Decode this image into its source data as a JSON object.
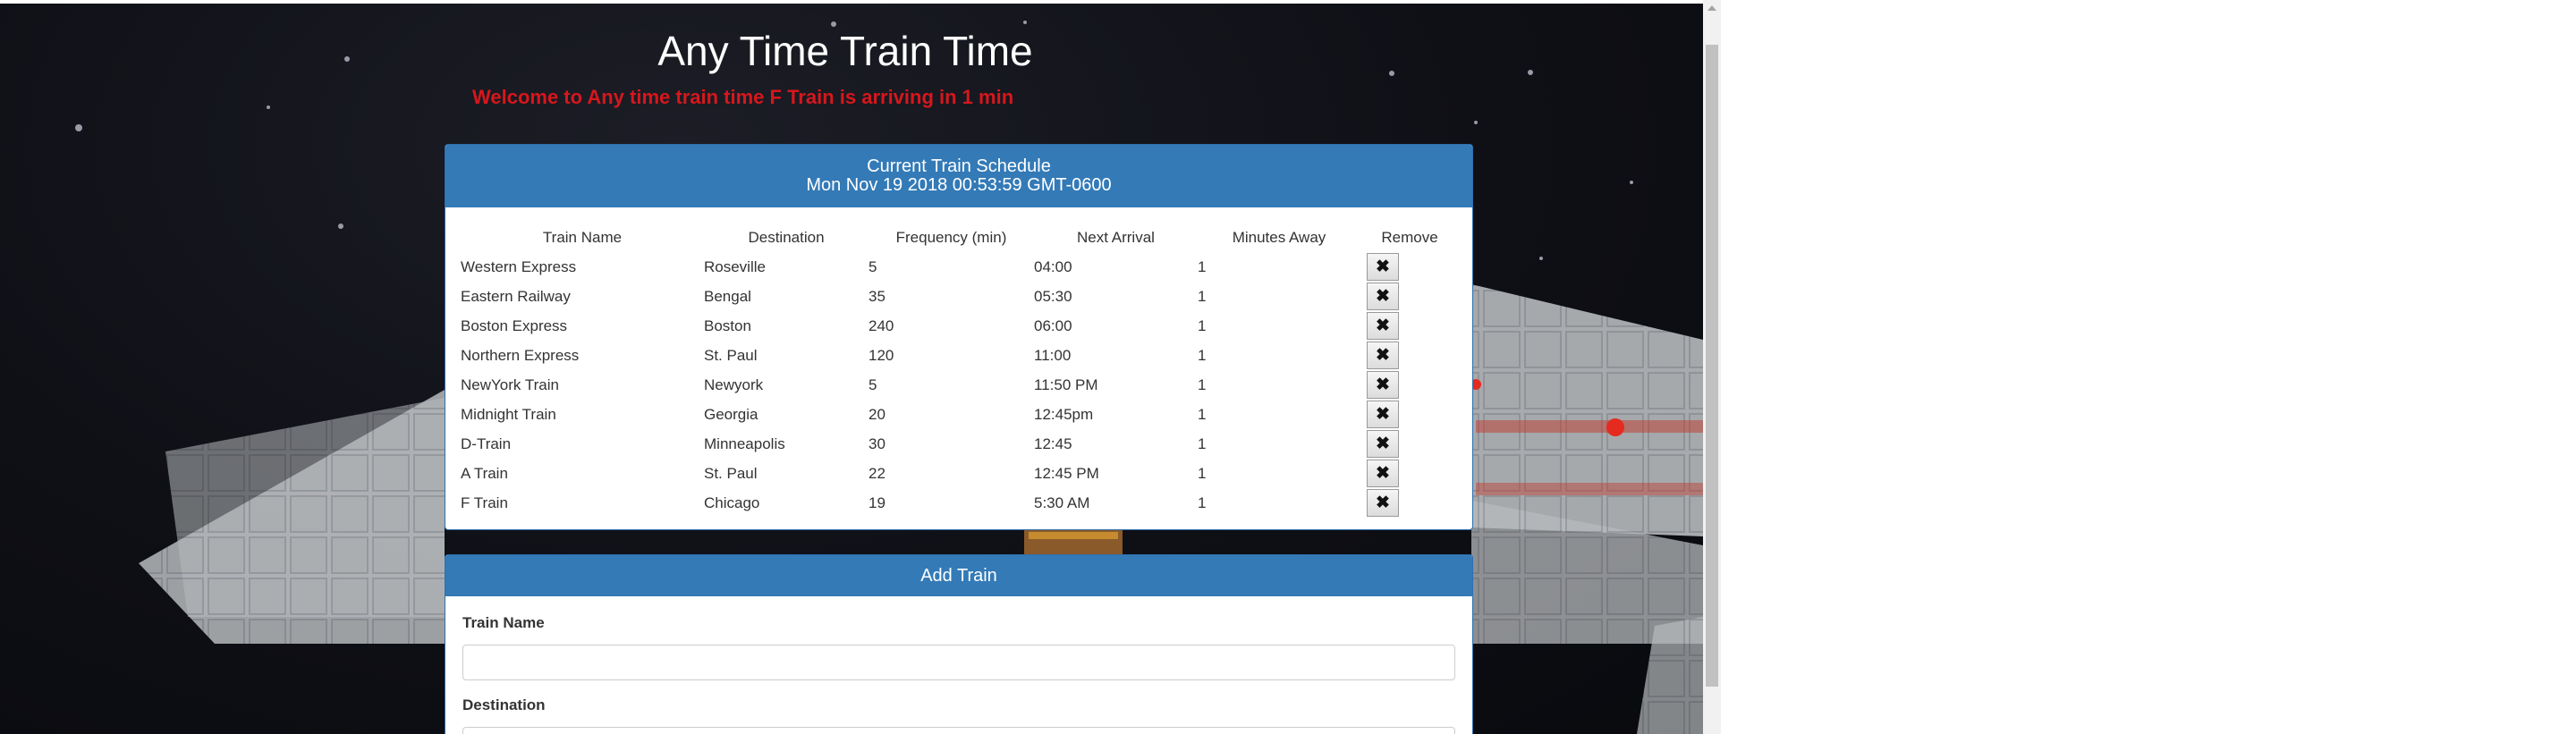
{
  "page": {
    "title": "Any Time Train Time",
    "welcome": "Welcome to Any time train time F Train is arriving in 1 min"
  },
  "schedule": {
    "heading": "Current Train Schedule",
    "timestamp": "Mon Nov 19 2018 00:53:59 GMT-0600",
    "columns": [
      "Train Name",
      "Destination",
      "Frequency (min)",
      "Next Arrival",
      "Minutes Away",
      "Remove"
    ],
    "rows": [
      {
        "name": "Western Express",
        "destination": "Roseville",
        "frequency": "5",
        "next_arrival": "04:00",
        "minutes_away": "1"
      },
      {
        "name": "Eastern Railway",
        "destination": "Bengal",
        "frequency": "35",
        "next_arrival": "05:30",
        "minutes_away": "1"
      },
      {
        "name": "Boston Express",
        "destination": "Boston",
        "frequency": "240",
        "next_arrival": "06:00",
        "minutes_away": "1"
      },
      {
        "name": "Northern Express",
        "destination": "St. Paul",
        "frequency": "120",
        "next_arrival": "11:00",
        "minutes_away": "1"
      },
      {
        "name": "NewYork Train",
        "destination": "Newyork",
        "frequency": "5",
        "next_arrival": "11:50 PM",
        "minutes_away": "1"
      },
      {
        "name": "Midnight Train",
        "destination": "Georgia",
        "frequency": "20",
        "next_arrival": "12:45pm",
        "minutes_away": "1"
      },
      {
        "name": "D-Train",
        "destination": "Minneapolis",
        "frequency": "30",
        "next_arrival": "12:45",
        "minutes_away": "1"
      },
      {
        "name": "A Train",
        "destination": "St. Paul",
        "frequency": "22",
        "next_arrival": "12:45 PM",
        "minutes_away": "1"
      },
      {
        "name": "F Train",
        "destination": "Chicago",
        "frequency": "19",
        "next_arrival": "5:30 AM",
        "minutes_away": "1"
      }
    ],
    "remove_icon": "close-x-icon",
    "remove_glyph": "✖"
  },
  "add_train": {
    "heading": "Add Train",
    "train_name_label": "Train Name",
    "train_name_value": "",
    "destination_label": "Destination",
    "destination_value": ""
  },
  "colors": {
    "panel_heading": "#337ab7",
    "welcome_text": "#d6171c",
    "page_background": "#0f1016"
  }
}
